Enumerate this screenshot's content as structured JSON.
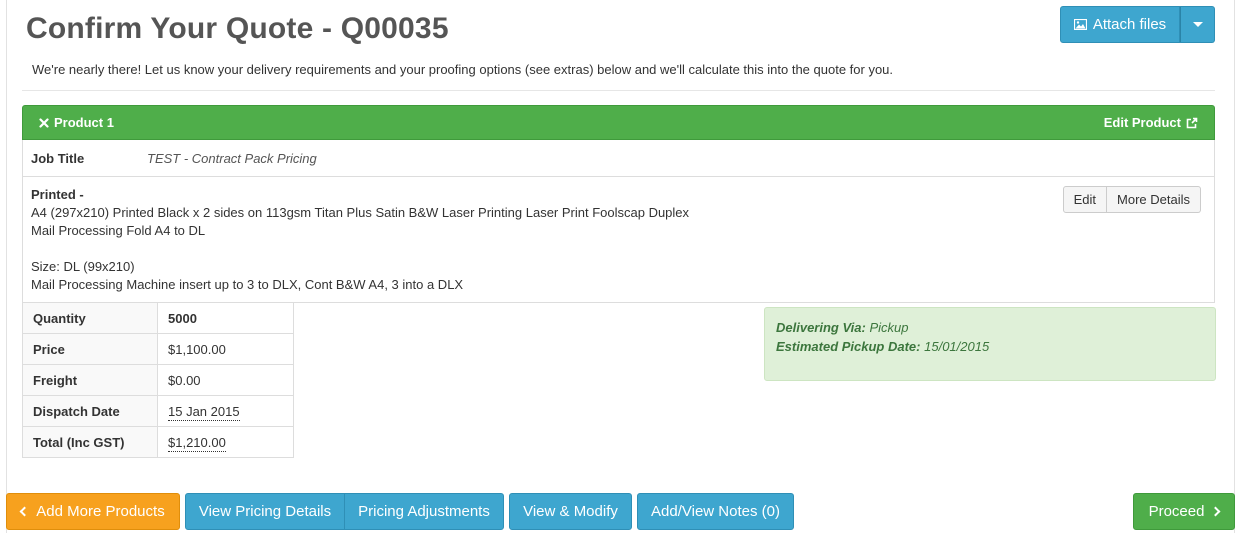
{
  "header": {
    "title": "Confirm Your Quote - Q00035",
    "attach_label": "Attach files",
    "intro": "We're nearly there! Let us know your delivery requirements and your proofing options (see extras) below and we'll calculate this into the quote for you."
  },
  "product": {
    "title": "Product 1",
    "edit_label": "Edit Product",
    "job_title_label": "Job Title",
    "job_title_value": "TEST - Contract Pack Pricing",
    "spec_heading": "Printed -",
    "spec_line1": "A4 (297x210) Printed Black x 2 sides on 113gsm Titan Plus Satin B&W Laser Printing Laser Print Foolscap Duplex",
    "spec_line2": "Mail Processing Fold A4 to DL",
    "spec_line3": "Size: DL (99x210)",
    "spec_line4": "Mail Processing Machine insert up to 3 to DLX, Cont B&W A4, 3 into a DLX",
    "edit_button": "Edit",
    "more_details_button": "More Details"
  },
  "summary": {
    "rows": [
      {
        "label": "Quantity",
        "value": "5000"
      },
      {
        "label": "Price",
        "value": "$1,100.00"
      },
      {
        "label": "Freight",
        "value": "$0.00"
      },
      {
        "label": "Dispatch Date",
        "value": "15 Jan 2015"
      },
      {
        "label": "Total (Inc GST)",
        "value": "$1,210.00"
      }
    ]
  },
  "delivery": {
    "via_label": "Delivering Via:",
    "via_value": "Pickup",
    "date_label": "Estimated Pickup Date:",
    "date_value": "15/01/2015"
  },
  "footer": {
    "add_more": "Add More Products",
    "view_pricing": "View Pricing Details",
    "pricing_adjustments": "Pricing Adjustments",
    "view_modify": "View & Modify",
    "notes": "Add/View Notes (0)",
    "proceed": "Proceed"
  },
  "colors": {
    "green": "#4fae4a",
    "blue": "#3ea6cf",
    "orange": "#f7a11e",
    "success_bg": "#dff0d8"
  }
}
